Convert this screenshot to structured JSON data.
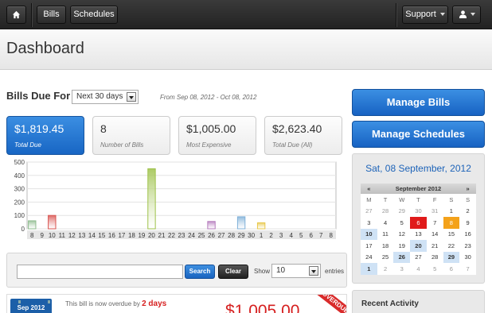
{
  "topbar": {
    "home_icon": "home-icon",
    "nav": [
      "Bills",
      "Schedules"
    ],
    "support_label": "Support",
    "user_icon": "user-icon"
  },
  "header": {
    "title": "Dashboard"
  },
  "bills_due": {
    "label": "Bills Due For",
    "period": "Next 30 days",
    "range": "From Sep 08, 2012 - Oct 08, 2012"
  },
  "stats": [
    {
      "value": "$1,819.45",
      "label": "Total Due"
    },
    {
      "value": "8",
      "label": "Number of Bills"
    },
    {
      "value": "$1,005.00",
      "label": "Most Expensive"
    },
    {
      "value": "$2,623.40",
      "label": "Total Due (All)"
    }
  ],
  "chart_data": {
    "type": "bar",
    "ylim": [
      0,
      500
    ],
    "yticks": [
      0,
      100,
      200,
      300,
      400,
      500
    ],
    "grid": true,
    "categories": [
      "8",
      "9",
      "10",
      "11",
      "12",
      "13",
      "14",
      "15",
      "16",
      "17",
      "18",
      "19",
      "20",
      "21",
      "22",
      "23",
      "24",
      "25",
      "26",
      "27",
      "28",
      "29",
      "30",
      "1",
      "2",
      "3",
      "4",
      "5",
      "6",
      "7",
      "8"
    ],
    "values": [
      60,
      0,
      100,
      0,
      0,
      0,
      0,
      0,
      0,
      0,
      0,
      0,
      450,
      0,
      0,
      0,
      0,
      0,
      55,
      0,
      0,
      90,
      0,
      45,
      0,
      0,
      0,
      0,
      0,
      0,
      0
    ],
    "bar_colors": [
      "#8fbc8f",
      "",
      "#d9534f",
      "",
      "",
      "",
      "",
      "",
      "",
      "",
      "",
      "",
      "#9ec24a",
      "",
      "",
      "",
      "",
      "",
      "#b57bbd",
      "",
      "",
      "#7fb0d8",
      "",
      "#e8c84a",
      "",
      "",
      "",
      "",
      "",
      "",
      ""
    ]
  },
  "table_controls": {
    "search_label": "Search",
    "clear_label": "Clear",
    "show_label": "Show",
    "entries_count": "10",
    "entries_label": "entries"
  },
  "bill": {
    "month": "Sep 2012",
    "note_prefix": "This bill is now overdue by",
    "overdue_days": "2 days",
    "amount": "$1,005.00",
    "ribbon": "OVERDUE"
  },
  "sidebar": {
    "manage_bills": "Manage Bills",
    "manage_schedules": "Manage Schedules",
    "date_title": "Sat, 08 September, 2012",
    "calendar": {
      "prev": "«",
      "month": "September 2012",
      "next": "»",
      "weekdays": [
        "M",
        "T",
        "W",
        "T",
        "F",
        "S",
        "S"
      ],
      "weeks": [
        [
          "27",
          "28",
          "29",
          "30",
          "31",
          "1",
          "2"
        ],
        [
          "3",
          "4",
          "5",
          "6",
          "7",
          "8",
          "9"
        ],
        [
          "10",
          "11",
          "12",
          "13",
          "14",
          "15",
          "16"
        ],
        [
          "17",
          "18",
          "19",
          "20",
          "21",
          "22",
          "23"
        ],
        [
          "24",
          "25",
          "26",
          "27",
          "28",
          "29",
          "30"
        ],
        [
          "1",
          "2",
          "3",
          "4",
          "5",
          "6",
          "7"
        ]
      ]
    },
    "recent_activity": "Recent Activity"
  }
}
